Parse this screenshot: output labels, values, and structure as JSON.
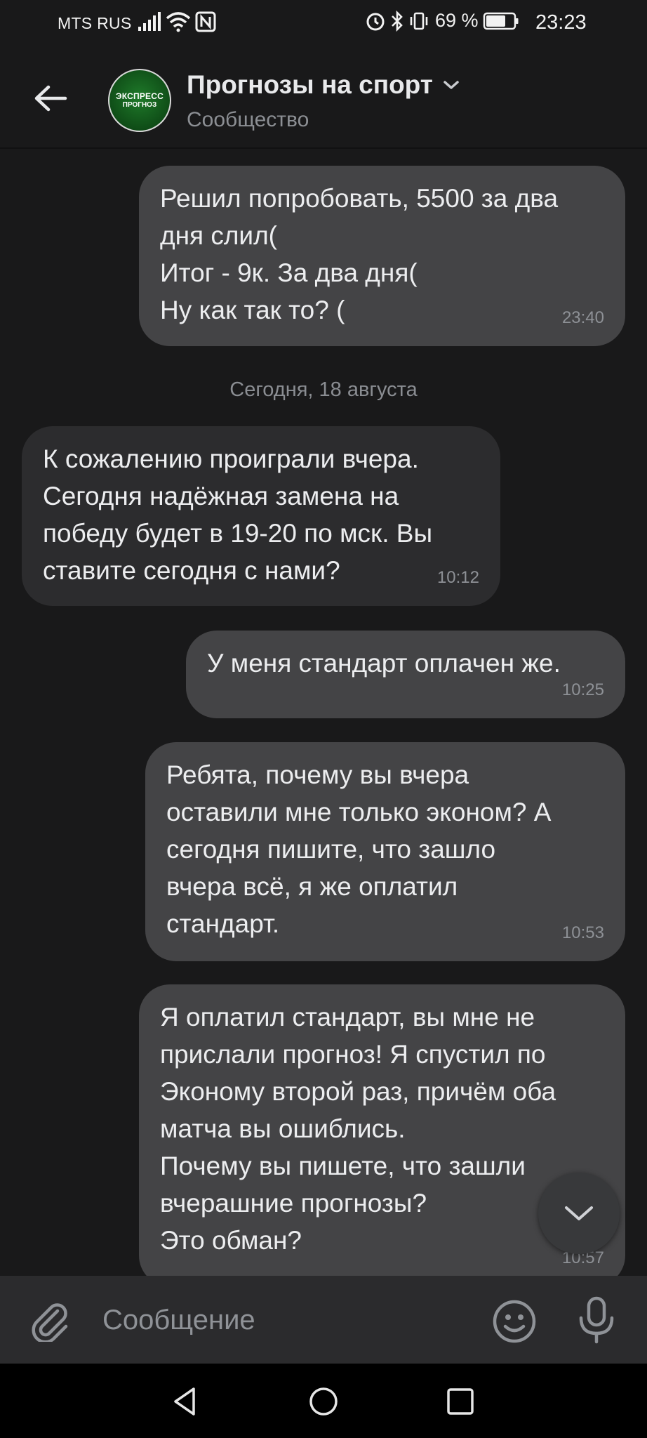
{
  "status_bar": {
    "carrier": "MTS RUS",
    "battery_percent": "69 %",
    "time": "23:23",
    "icons": [
      "signal-icon",
      "wifi-icon",
      "nfc-icon",
      "alarm-icon",
      "bluetooth-icon",
      "vibrate-icon",
      "battery-icon"
    ]
  },
  "header": {
    "title": "Прогнозы на спорт",
    "subtitle": "Сообщество",
    "avatar_line1": "ЭКСПРЕСС",
    "avatar_line2": "ПРОГНОЗ",
    "avatar_color": "#1f7a2a"
  },
  "chat": {
    "date_separator": "Сегодня, 18 августа",
    "messages": [
      {
        "direction": "outgoing",
        "text": "Решил попробовать, 5500 за два\nдня слил(\nИтог - 9к. За два дня(\nНу как так то? (",
        "time": "23:40"
      },
      {
        "direction": "incoming",
        "text": "К сожалению проиграли вчера.\nСегодня надёжная замена на\nпобеду будет в 19-20 по мск. Вы\nставите сегодня с нами?",
        "time": "10:12"
      },
      {
        "direction": "outgoing",
        "text": "У меня стандарт оплачен же.",
        "time": "10:25"
      },
      {
        "direction": "outgoing",
        "text": "Ребята, почему вы вчера\nоставили мне только эконом? А\nсегодня пишите, что зашло\nвчера всё, я же оплатил\nстандарт.",
        "time": "10:53"
      },
      {
        "direction": "outgoing",
        "text": "Я оплатил стандарт, вы мне не\nприслали прогноз! Я спустил по\nЭконому второй раз, причём оба\nматча вы ошиблись.\nПочему вы пишете, что зашли\nвчерашние прогнозы?\nЭто обман?",
        "time": "10:57"
      }
    ]
  },
  "composer": {
    "placeholder": "Сообщение"
  },
  "colors": {
    "background": "#19191a",
    "outgoing_bubble": "#444446",
    "incoming_bubble": "#2c2c2e",
    "composer": "#2b2b2d",
    "nav_bar": "#000000"
  }
}
